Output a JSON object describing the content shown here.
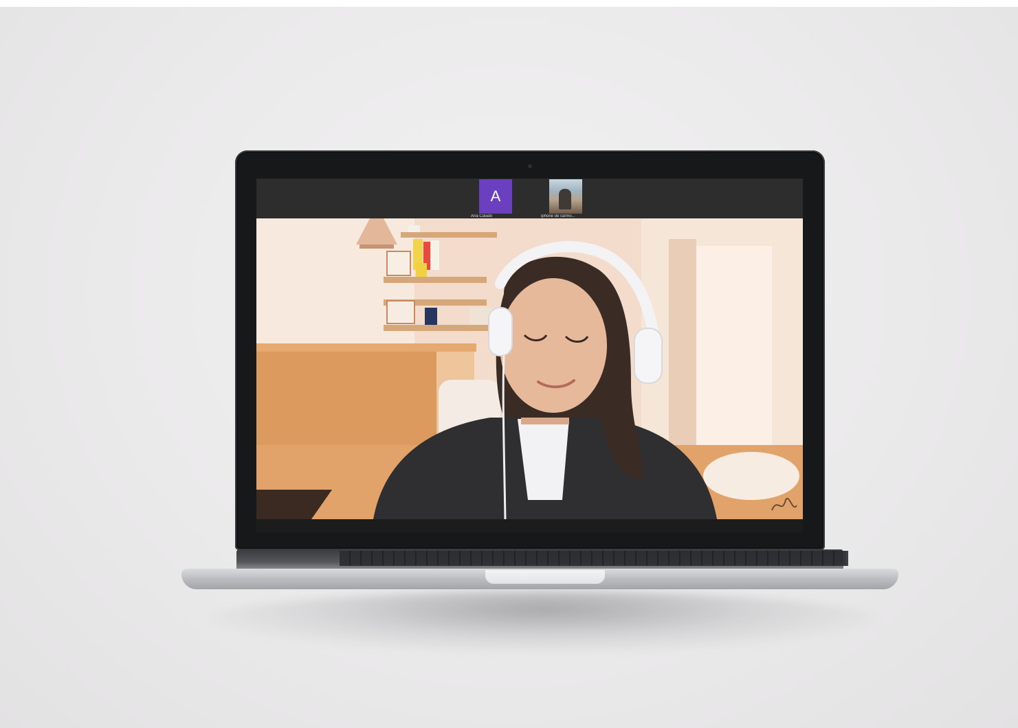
{
  "participants": [
    {
      "initial": "A",
      "name": "Ana Calado",
      "kind": "avatar",
      "avatar_color": "#6a3fc0"
    },
    {
      "initial": "",
      "name": "iphone de carmo...",
      "kind": "camera"
    }
  ],
  "colors": {
    "avatar_bg": "#6a3fc0",
    "bar_bg": "#2d2d2e",
    "bezel": "#17181a"
  },
  "icons": [
    "camera-icon",
    "signature-mark-icon"
  ]
}
